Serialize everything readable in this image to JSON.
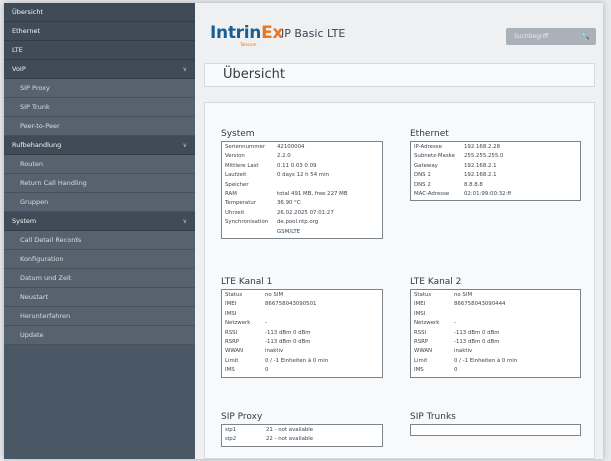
{
  "sidebar": {
    "items": [
      {
        "label": "Übersicht",
        "type": "top"
      },
      {
        "label": "Ethernet",
        "type": "top"
      },
      {
        "label": "LTE",
        "type": "top"
      },
      {
        "label": "VoIP",
        "type": "top",
        "expandable": true
      },
      {
        "label": "SIP Proxy",
        "type": "sub"
      },
      {
        "label": "SIP Trunk",
        "type": "sub"
      },
      {
        "label": "Peer-to-Peer",
        "type": "sub"
      },
      {
        "label": "Rufbehandlung",
        "type": "top",
        "expandable": true
      },
      {
        "label": "Routen",
        "type": "sub"
      },
      {
        "label": "Return Call Handling",
        "type": "sub"
      },
      {
        "label": "Gruppen",
        "type": "sub"
      },
      {
        "label": "System",
        "type": "top",
        "expandable": true
      },
      {
        "label": "Call Detail Records",
        "type": "sub"
      },
      {
        "label": "Konfiguration",
        "type": "sub"
      },
      {
        "label": "Datum und Zeit",
        "type": "sub"
      },
      {
        "label": "Neustart",
        "type": "sub"
      },
      {
        "label": "Herunterfahren",
        "type": "sub"
      },
      {
        "label": "Update",
        "type": "sub"
      }
    ]
  },
  "header": {
    "logo_main": "Intrin",
    "logo_accent": "Ex",
    "logo_sub": "Telecom",
    "product": "IP Basic LTE",
    "search_placeholder": "Suchbegriff",
    "search_icon": "magnifier-icon"
  },
  "page": {
    "title": "Übersicht"
  },
  "system": {
    "title": "System",
    "rows": [
      {
        "k": "Seriennummer",
        "v": "42100004"
      },
      {
        "k": "Version",
        "v": "2.2.0"
      },
      {
        "k": "Mittlere Last",
        "v": "0.11 0.03 0.09"
      },
      {
        "k": "Laufzeit",
        "v": "0 days 12 h 54 min"
      },
      {
        "k": "Speicher",
        "v": ""
      },
      {
        "k": "RAM",
        "v": "total 491 MB, free 227 MB"
      },
      {
        "k": "Temperatur",
        "v": "36.90 °C"
      },
      {
        "k": "Uhrzeit",
        "v": "26.02.2025 07:01:27"
      },
      {
        "k": "Synchronisation",
        "v": "de.pool.ntp.org"
      },
      {
        "k": "",
        "v": "GSM/LTE"
      }
    ]
  },
  "ethernet": {
    "title": "Ethernet",
    "rows": [
      {
        "k": "IP-Adresse",
        "v": "192.168.2.28"
      },
      {
        "k": "Subnetz-Maske",
        "v": "255.255.255.0"
      },
      {
        "k": "Gateway",
        "v": "192.168.2.1"
      },
      {
        "k": "DNS 1",
        "v": "192.168.2.1"
      },
      {
        "k": "DNS 2",
        "v": "8.8.8.8"
      },
      {
        "k": "MAC-Adresse",
        "v": "02:01:99:00:32:ff"
      }
    ]
  },
  "lte1": {
    "title": "LTE Kanal 1",
    "rows": [
      {
        "k": "Status",
        "v": "no SIM"
      },
      {
        "k": "IMEI",
        "v": "866758043090501"
      },
      {
        "k": "IMSI",
        "v": ""
      },
      {
        "k": "Netzwerk",
        "v": "-"
      },
      {
        "k": "RSSI",
        "v": "-113 dBm   0 dBm"
      },
      {
        "k": "RSRP",
        "v": "-113 dBm   0 dBm"
      },
      {
        "k": "WWAN",
        "v": "inaktiv"
      },
      {
        "k": "Limit",
        "v": "0 / -1 Einheiten à 0 min"
      },
      {
        "k": "IMS",
        "v": "0"
      }
    ]
  },
  "lte2": {
    "title": "LTE Kanal 2",
    "rows": [
      {
        "k": "Status",
        "v": "no SIM"
      },
      {
        "k": "IMEI",
        "v": "866758043090444"
      },
      {
        "k": "IMSI",
        "v": ""
      },
      {
        "k": "Netzwerk",
        "v": "-"
      },
      {
        "k": "RSSI",
        "v": "-113 dBm   0 dBm"
      },
      {
        "k": "RSRP",
        "v": "-113 dBm   0 dBm"
      },
      {
        "k": "WWAN",
        "v": "inaktiv"
      },
      {
        "k": "Limit",
        "v": "0 / -1 Einheiten à 0 min"
      },
      {
        "k": "IMS",
        "v": "0"
      }
    ]
  },
  "sip_proxy": {
    "title": "SIP Proxy",
    "rows": [
      {
        "k": "sip1",
        "v": "21 - not available"
      },
      {
        "k": "sip2",
        "v": "22 - not available"
      }
    ]
  },
  "sip_trunks": {
    "title": "SIP Trunks"
  },
  "colors": {
    "sidebar_bg": "#4a5866",
    "logo_blue": "#1b5f92",
    "logo_orange": "#e87722"
  }
}
